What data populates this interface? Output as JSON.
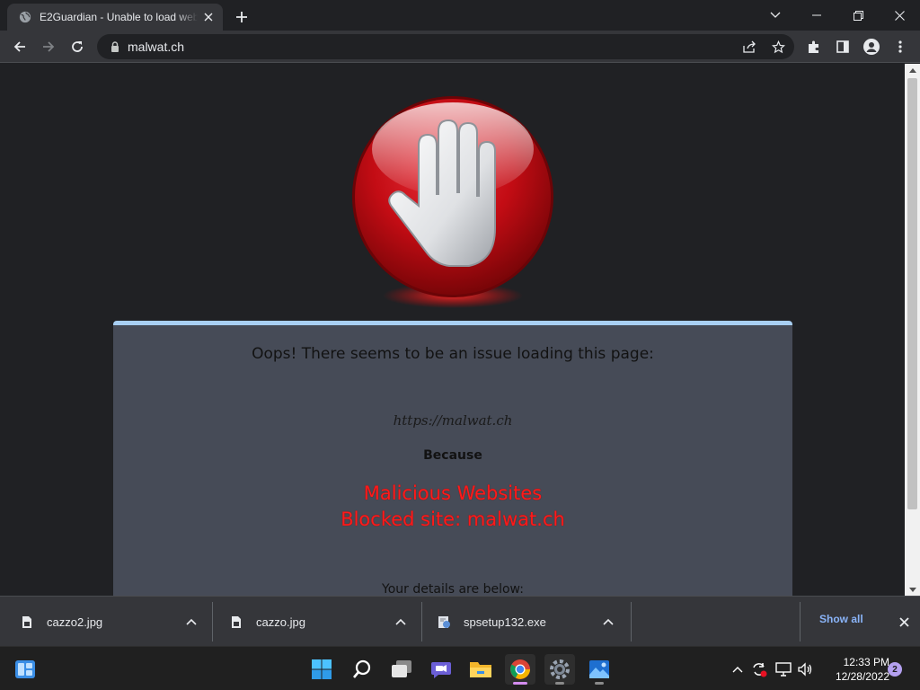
{
  "browser": {
    "tab": {
      "title": "E2Guardian - Unable to load web page",
      "favicon": "globe-icon"
    },
    "address": {
      "url": "malwat.ch"
    },
    "colors": {
      "tab_bg": "#35363a",
      "frame_bg": "#202124",
      "text": "#e8eaed"
    }
  },
  "page": {
    "heading": "Oops! There seems to be an issue loading this page:",
    "blocked_url": "https://malwat.ch",
    "because_label": "Because",
    "reason_line1": "Malicious Websites",
    "reason_line2": "Blocked site: malwat.ch",
    "details_text": "Your details are below:",
    "colors": {
      "panel_bg": "#464b57",
      "panel_border": "#a8cff3",
      "reason": "#ff1a1a",
      "stop_red": "#d10f14"
    }
  },
  "downloads": {
    "items": [
      {
        "name": "cazzo2.jpg",
        "icon": "image-file-icon"
      },
      {
        "name": "cazzo.jpg",
        "icon": "image-file-icon"
      },
      {
        "name": "spsetup132.exe",
        "icon": "installer-file-icon"
      }
    ],
    "show_all": "Show all"
  },
  "taskbar": {
    "time": "12:33 PM",
    "date": "12/28/2022",
    "notification_count": "2",
    "apps": [
      "start-icon",
      "search-icon",
      "task-view-icon",
      "teams-chat-icon",
      "file-explorer-icon",
      "chrome-icon",
      "settings-icon",
      "photos-icon"
    ]
  }
}
